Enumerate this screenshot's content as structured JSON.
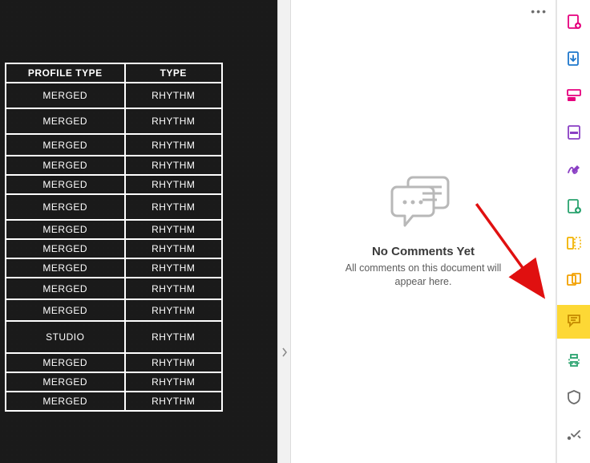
{
  "doc_table": {
    "headers": {
      "col1": "Profile Type",
      "col2": "Type"
    },
    "rows": [
      {
        "c1": "Merged",
        "c2": "Rhythm",
        "h": "r-h32"
      },
      {
        "c1": "Merged",
        "c2": "Rhythm",
        "h": "r-h32"
      },
      {
        "c1": "Merged",
        "c2": "Rhythm",
        "h": "r-h27"
      },
      {
        "c1": "Merged",
        "c2": "Rhythm",
        "h": "r-h24"
      },
      {
        "c1": "Merged",
        "c2": "Rhythm",
        "h": "r-h24"
      },
      {
        "c1": "Merged",
        "c2": "Rhythm",
        "h": "r-h32"
      },
      {
        "c1": "Merged",
        "c2": "Rhythm",
        "h": "r-h24"
      },
      {
        "c1": "Merged",
        "c2": "Rhythm",
        "h": "r-h24"
      },
      {
        "c1": "Merged",
        "c2": "Rhythm",
        "h": "r-h24"
      },
      {
        "c1": "Merged",
        "c2": "Rhythm",
        "h": "r-h27"
      },
      {
        "c1": "Merged",
        "c2": "Rhythm",
        "h": "r-h27"
      },
      {
        "c1": "Studio",
        "c2": "Rhythm",
        "h": "r-h40"
      },
      {
        "c1": "Merged",
        "c2": "Rhythm",
        "h": "r-h24"
      },
      {
        "c1": "Merged",
        "c2": "Rhythm",
        "h": "r-h24"
      },
      {
        "c1": "Merged",
        "c2": "Rhythm",
        "h": "r-h24"
      }
    ]
  },
  "panel": {
    "menu_glyph": "•••",
    "empty_title": "No Comments Yet",
    "empty_sub_l1": "All comments on this document will",
    "empty_sub_l2": "appear here."
  },
  "rail_tools": [
    {
      "name": "create-pdf-icon",
      "color": "#e6007e",
      "active": false
    },
    {
      "name": "export-pdf-icon",
      "color": "#1d77cc",
      "active": false
    },
    {
      "name": "edit-pdf-icon",
      "color": "#e6007e",
      "active": false
    },
    {
      "name": "redact-icon",
      "color": "#8a3fc4",
      "active": false
    },
    {
      "name": "sign-icon",
      "color": "#8a3fc4",
      "active": false
    },
    {
      "name": "organize-icon",
      "color": "#2aa36f",
      "active": false
    },
    {
      "name": "compare-icon",
      "color": "#f2b200",
      "active": false
    },
    {
      "name": "combine-icon",
      "color": "#f2a000",
      "active": false
    },
    {
      "name": "comment-icon",
      "color": "#c58a00",
      "active": true
    },
    {
      "name": "print-icon",
      "color": "#2aa36f",
      "active": false
    },
    {
      "name": "protect-icon",
      "color": "#6b6b6b",
      "active": false
    },
    {
      "name": "more-tools-icon",
      "color": "#6b6b6b",
      "active": false
    }
  ],
  "colors": {
    "arrow": "#e01010",
    "highlight": "#fdd835"
  }
}
